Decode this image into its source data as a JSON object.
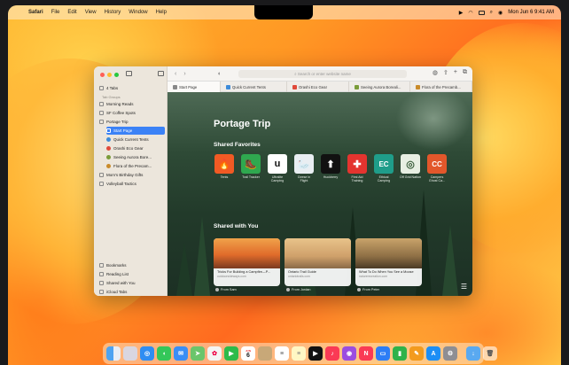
{
  "menubar": {
    "app": "Safari",
    "items": [
      "File",
      "Edit",
      "View",
      "History",
      "Window",
      "Help"
    ],
    "datetime": "Mon Jun 6  9:41 AM"
  },
  "sidebar": {
    "tabs_label": "4 Tabs",
    "section_header": "Tab Groups",
    "groups": [
      {
        "label": "Morning Reads"
      },
      {
        "label": "SF Coffee Spots"
      },
      {
        "label": "Portage Trip"
      }
    ],
    "tabs": [
      {
        "label": "Start Page",
        "color": "#3b82f6"
      },
      {
        "label": "Quick Current Tents",
        "color": "#3d8bd9"
      },
      {
        "label": "Orashi Eco Gear",
        "color": "#e0493a"
      },
      {
        "label": "Seeing Aurora Bore...",
        "color": "#7a9c3a"
      },
      {
        "label": "Flora of the Precam...",
        "color": "#c98b2a"
      }
    ],
    "more_groups": [
      {
        "label": "Mom's Birthday Gifts"
      },
      {
        "label": "Volleyball Tactics"
      }
    ],
    "bottom": [
      {
        "label": "Bookmarks"
      },
      {
        "label": "Reading List"
      },
      {
        "label": "Shared with You"
      },
      {
        "label": "iCloud Tabs"
      }
    ]
  },
  "toolbar": {
    "address_placeholder": "Search or enter website name"
  },
  "tabs": [
    {
      "label": "Start Page",
      "color": "#888888"
    },
    {
      "label": "Quick Current Tents",
      "color": "#3d8bd9"
    },
    {
      "label": "Orashi Eco Gear",
      "color": "#e0493a"
    },
    {
      "label": "Seeing Aurora Boreali...",
      "color": "#7a9c3a"
    },
    {
      "label": "Flora of the Precamb...",
      "color": "#c98b2a"
    }
  ],
  "startpage": {
    "title": "Portage Trip",
    "favorites_heading": "Shared Favorites",
    "favorites": [
      {
        "label": "Tents",
        "glyph": "🔥",
        "color": "#f15a24"
      },
      {
        "label": "Trail Tracker",
        "glyph": "🥾",
        "color": "#2fa84f"
      },
      {
        "label": "Ultralite Camping",
        "glyph": "u",
        "color": "#ffffff"
      },
      {
        "label": "Geese in Flight",
        "glyph": "🦢",
        "color": "#e9eef2"
      },
      {
        "label": "Huckberry",
        "glyph": "⬆",
        "color": "#111111"
      },
      {
        "label": "First Aid Training",
        "glyph": "✚",
        "color": "#e3342f"
      },
      {
        "label": "Ethical Camping",
        "glyph": "EC",
        "color": "#1f9d8a"
      },
      {
        "label": "Off Grid Nation",
        "glyph": "◎",
        "color": "#e8efe3"
      },
      {
        "label": "Campers Ghost Ca...",
        "glyph": "CC",
        "color": "#e2572b"
      }
    ],
    "shared_heading": "Shared with You",
    "cards": [
      {
        "title": "Tricks For Building a Campfire—P...",
        "site": "outdoorsideways.com",
        "from": "From Sam"
      },
      {
        "title": "Ontario Trail Guide",
        "site": "ontariotrails.com",
        "from": "From Jordan"
      },
      {
        "title": "What To Do When You See a Moose",
        "site": "naturerecreation.com",
        "from": "From Peter"
      }
    ]
  },
  "dock": {
    "apps": [
      "finder-icon",
      "launchpad-icon",
      "safari-icon",
      "messages-icon",
      "mail-icon",
      "maps-icon",
      "photos-icon",
      "facetime-icon",
      "calendar-icon",
      "contacts-icon",
      "reminders-icon",
      "notes-icon",
      "tv-icon",
      "music-icon",
      "podcasts-icon",
      "news-icon",
      "keynote-icon",
      "numbers-icon",
      "pages-icon",
      "appstore-icon",
      "settings-icon",
      "downloads-icon",
      "trash-icon"
    ],
    "calendar_day": "6",
    "calendar_month": "JUN"
  }
}
